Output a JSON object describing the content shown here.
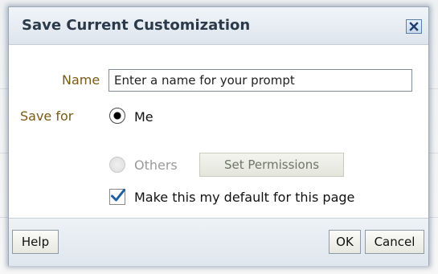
{
  "dialog": {
    "title": "Save Current Customization",
    "close_icon": "close-x-icon"
  },
  "form": {
    "name_label": "Name",
    "name_value": "Enter a name for your prompt",
    "save_for_label": "Save for",
    "options": [
      {
        "label": "Me",
        "selected": true,
        "enabled": true
      },
      {
        "label": "Others",
        "selected": false,
        "enabled": false
      }
    ],
    "permissions_button": "Set Permissions",
    "default_checkbox": {
      "label": "Make this my default for this page",
      "checked": true
    }
  },
  "footer": {
    "help_label": "Help",
    "ok_label": "OK",
    "cancel_label": "Cancel"
  },
  "colors": {
    "label_color": "#7a5a14",
    "title_color": "#2b3a4a",
    "disabled_text": "#9a9a9a",
    "check_color": "#1f5fa0"
  }
}
